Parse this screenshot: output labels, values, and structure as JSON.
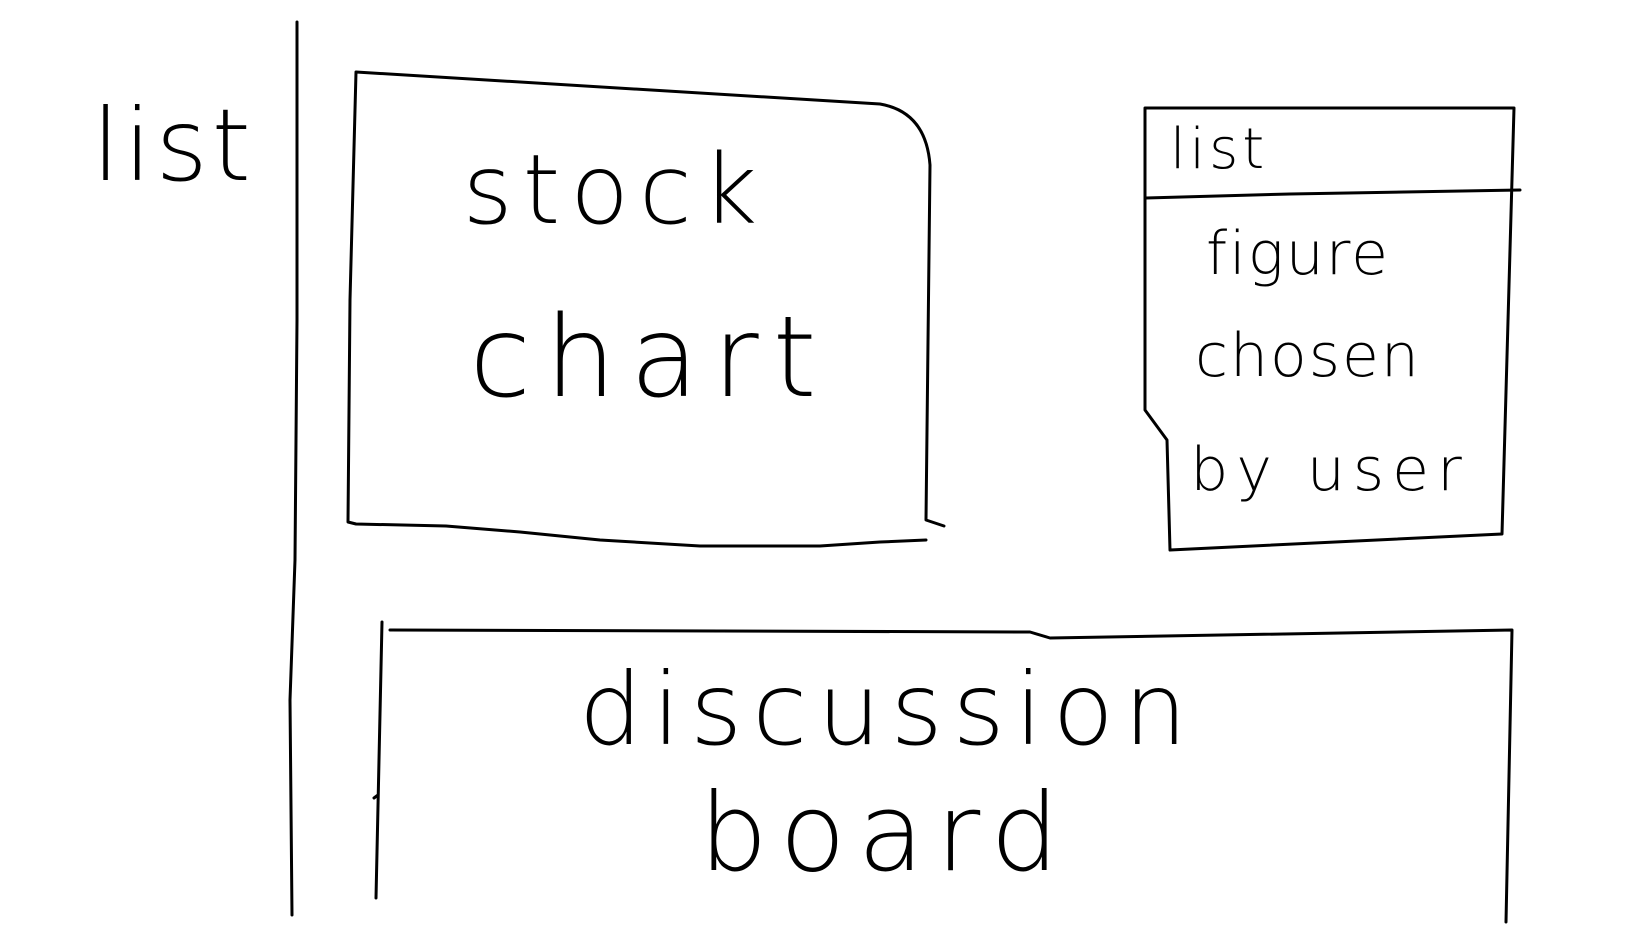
{
  "sidebar": {
    "label": "list"
  },
  "stock_chart_panel": {
    "line1": "stock",
    "line2": "chart"
  },
  "figure_panel": {
    "header": "list",
    "line1": "figure",
    "line2": "chosen",
    "line3": "by user"
  },
  "discussion_panel": {
    "line1": "discussion",
    "line2": "board"
  },
  "colors": {
    "ink": "#000000",
    "paper": "#ffffff"
  }
}
